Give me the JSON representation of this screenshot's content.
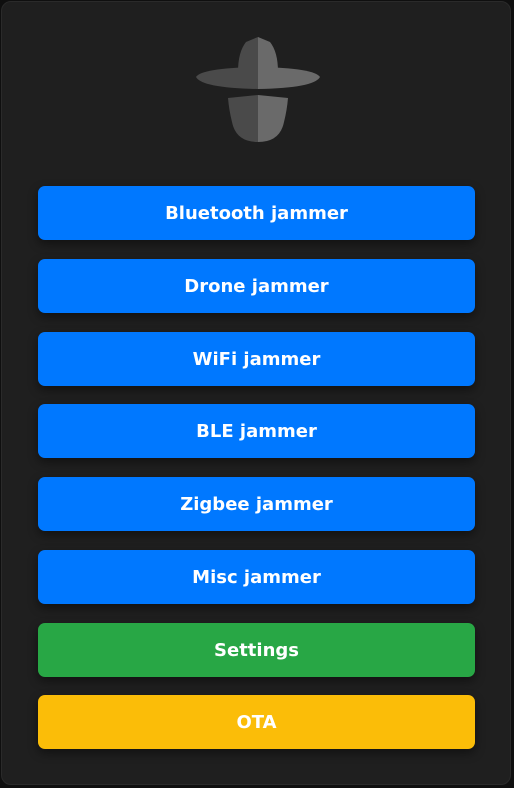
{
  "logo": {
    "icon": "spy-hat-icon"
  },
  "buttons": {
    "bluetooth": "Bluetooth jammer",
    "drone": "Drone jammer",
    "wifi": "WiFi jammer",
    "ble": "BLE jammer",
    "zigbee": "Zigbee jammer",
    "misc": "Misc jammer",
    "settings": "Settings",
    "ota": "OTA"
  },
  "colors": {
    "background": "#1f1f1f",
    "primary": "#0078ff",
    "settings": "#28a745",
    "ota": "#fbbd08",
    "text": "#ffffff"
  }
}
